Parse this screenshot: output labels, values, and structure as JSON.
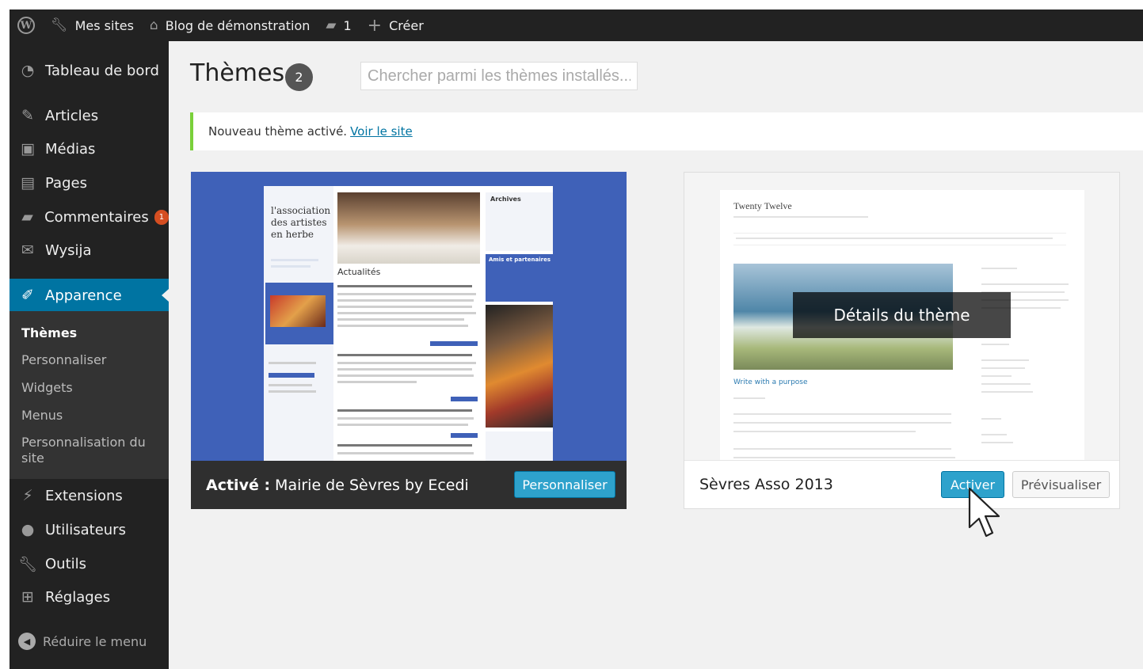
{
  "admin_bar": {
    "my_sites": "Mes sites",
    "site_name": "Blog de démonstration",
    "comments_count": "1",
    "new_label": "Créer"
  },
  "sidebar": {
    "dashboard": "Tableau de bord",
    "posts": "Articles",
    "media": "Médias",
    "pages": "Pages",
    "comments": "Commentaires",
    "comments_badge": "1",
    "wysija": "Wysija",
    "appearance": "Apparence",
    "submenu": [
      "Thèmes",
      "Personnaliser",
      "Widgets",
      "Menus",
      "Personnalisation du site"
    ],
    "plugins": "Extensions",
    "users": "Utilisateurs",
    "tools": "Outils",
    "settings": "Réglages",
    "collapse": "Réduire le menu"
  },
  "header": {
    "title": "Thèmes",
    "theme_count": "2",
    "search_placeholder": "Chercher parmi les thèmes installés..."
  },
  "notice": {
    "text": "Nouveau thème activé.",
    "link": "Voir le site"
  },
  "themes": [
    {
      "active_prefix": "Activé :",
      "name": "Mairie de Sèvres by Ecedi",
      "button": "Personnaliser",
      "screenshot": {
        "heading": "l'association des artistes en herbe",
        "news": "Actualités",
        "archives": "Archives",
        "friends": "Amis et partenaires"
      }
    },
    {
      "name": "Sèvres Asso 2013",
      "activate": "Activer",
      "preview": "Prévisualiser",
      "details": "Détails du thème",
      "screenshot": {
        "site_title": "Twenty Twelve",
        "post_title": "Write with a purpose"
      }
    }
  ],
  "colors": {
    "admin_bg": "#222222",
    "accent": "#0074a2",
    "button_primary": "#2ea2cc",
    "notice_border": "#7ad03a",
    "badge": "#d54e21"
  }
}
